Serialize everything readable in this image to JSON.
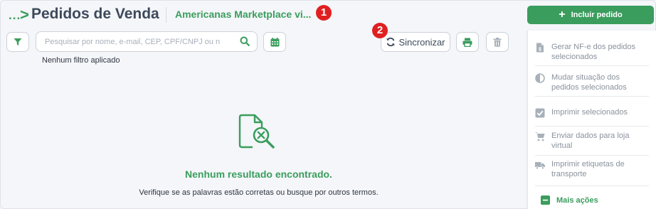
{
  "header": {
    "breadcrumb_dots": "...",
    "breadcrumb_chevron": ">",
    "title": "Pedidos de Venda",
    "store": "Americanas Marketplace vi...",
    "badge_1": "1",
    "badge_2": "2"
  },
  "toolbar": {
    "search_placeholder": "Pesquisar por nome, e-mail, CEP, CPF/CNPJ ou n",
    "filter_status": "Nenhum filtro aplicado",
    "sync_label": "Sincronizar"
  },
  "sidebar": {
    "include_label": "Incluir pedido",
    "actions": [
      {
        "icon": "document-icon",
        "label_1": "Gerar NF-e dos pedidos",
        "label_2": "selecionados"
      },
      {
        "icon": "half-circle-icon",
        "label_1": "Mudar situação dos",
        "label_2": "pedidos selecionados"
      },
      {
        "icon": "checkbox-icon",
        "label_1": "Imprimir selecionados",
        "label_2": ""
      },
      {
        "icon": "cart-icon",
        "label_1": "Enviar dados para loja",
        "label_2": "virtual"
      },
      {
        "icon": "truck-icon",
        "label_1": "Imprimir etiquetas de",
        "label_2": "transporte"
      }
    ],
    "more_label": "Mais ações"
  },
  "empty_state": {
    "title": "Nenhum resultado encontrado.",
    "subtitle": "Verifique se as palavras estão corretas ou busque por outros termos."
  },
  "colors": {
    "accent": "#3a9d5d",
    "title": "#3e4a5b",
    "badge": "#e02020",
    "muted": "#8a929c"
  }
}
